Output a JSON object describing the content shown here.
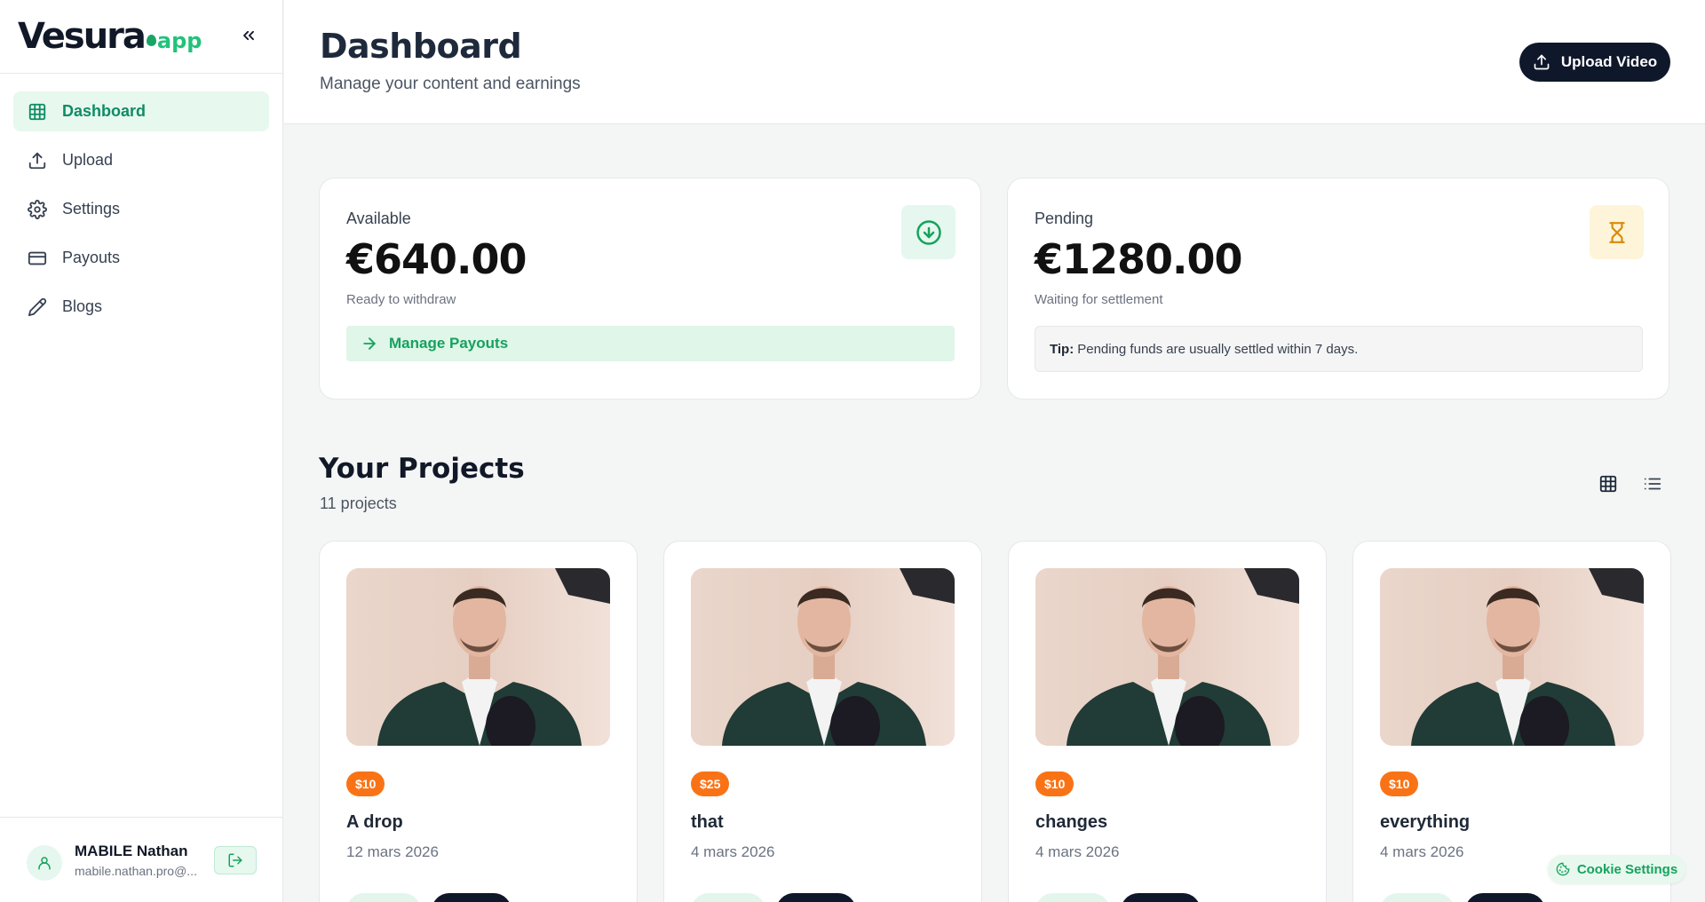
{
  "brand": {
    "name": "Vesura",
    "suffix": "app"
  },
  "sidebar": {
    "items": [
      {
        "label": "Dashboard",
        "icon": "grid-icon",
        "active": true
      },
      {
        "label": "Upload",
        "icon": "upload-icon",
        "active": false
      },
      {
        "label": "Settings",
        "icon": "gear-icon",
        "active": false
      },
      {
        "label": "Payouts",
        "icon": "credit-card-icon",
        "active": false
      },
      {
        "label": "Blogs",
        "icon": "pencil-icon",
        "active": false
      }
    ],
    "user": {
      "name": "MABILE Nathan",
      "email": "mabile.nathan.pro@..."
    }
  },
  "header": {
    "title": "Dashboard",
    "subtitle": "Manage your content and earnings",
    "upload_button": "Upload Video"
  },
  "balances": {
    "available": {
      "label": "Available",
      "amount": "€640.00",
      "note": "Ready to withdraw",
      "action": "Manage Payouts",
      "icon": "arrow-down-circle-icon"
    },
    "pending": {
      "label": "Pending",
      "amount": "€1280.00",
      "note": "Waiting for settlement",
      "tip_label": "Tip:",
      "tip_text": "Pending funds are usually settled within 7 days.",
      "icon": "hourglass-icon"
    }
  },
  "projects": {
    "title": "Your Projects",
    "count": "11 projects",
    "items": [
      {
        "price": "$10",
        "name": "A drop",
        "date": "12 mars 2026"
      },
      {
        "price": "$25",
        "name": "that",
        "date": "4 mars 2026"
      },
      {
        "price": "$10",
        "name": "changes",
        "date": "4 mars 2026"
      },
      {
        "price": "$10",
        "name": "everything",
        "date": "4 mars 2026"
      }
    ]
  },
  "cookie": {
    "label": "Cookie Settings"
  },
  "colors": {
    "accent": "#16a25d",
    "dark": "#0f172a",
    "price": "#f97316"
  }
}
